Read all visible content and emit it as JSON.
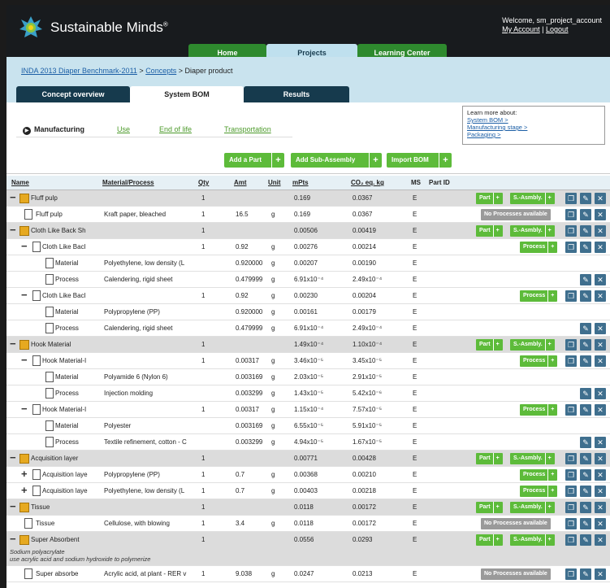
{
  "app": {
    "brand": "Sustainable Minds",
    "brand_mark": "®",
    "welcome": "Welcome, sm_project_account",
    "my_account": "My Account",
    "separator": " | ",
    "logout": "Logout"
  },
  "nav": {
    "tabs": [
      {
        "label": "Home",
        "color": "#2e8a2e"
      },
      {
        "label": "Projects",
        "color": "#bfe0ee"
      },
      {
        "label": "Learning Center",
        "color": "#2e8a2e"
      }
    ]
  },
  "breadcrumb": {
    "part1": "INDA 2013 Diaper Benchmark-2011",
    "sep1": " > ",
    "part2": "Concepts",
    "sep2": " > ",
    "current": "Diaper product"
  },
  "concept_tabs": [
    "Concept overview",
    "System BOM",
    "Results"
  ],
  "stage_tabs": {
    "active": "Manufacturing",
    "others": [
      "Use",
      "End of life",
      "Transportation"
    ]
  },
  "learn_more": {
    "title": "Learn more about:",
    "links": [
      "System BOM >",
      "Manufacturing stage >",
      "Packaging >"
    ]
  },
  "actions": {
    "add_part": "Add a Part",
    "add_sub": "Add Sub-Assembly",
    "import": "Import BOM",
    "plus": "+"
  },
  "columns": {
    "name": "Name",
    "material": "Material/Process",
    "qty": "Qty",
    "amt": "Amt",
    "unit": "Unit",
    "mpts": "mPts",
    "co2": "CO₂ eq. kg",
    "ms": "MS",
    "partid": "Part ID"
  },
  "row_buttons": {
    "part": "Part",
    "sasm": "S.-Asmbly.",
    "process": "Process",
    "noproc": "No Processes available",
    "plus": "+"
  },
  "rows": [
    {
      "kind": "grp",
      "exp": "−",
      "name": "Fluff pulp",
      "qty": "1",
      "mpts": "0.169",
      "co2": "0.0367",
      "ms": "E",
      "btns": "grp"
    },
    {
      "kind": "item",
      "name": "Fluff pulp",
      "mat": "Kraft paper, bleached",
      "qty": "1",
      "amt": "16.5",
      "unit": "g",
      "mpts": "0.169",
      "co2": "0.0367",
      "ms": "E",
      "btns": "noproc"
    },
    {
      "kind": "grp",
      "exp": "−",
      "name": "Cloth Like Back Sh",
      "qty": "1",
      "mpts": "0.00506",
      "co2": "0.00419",
      "ms": "E",
      "btns": "grp"
    },
    {
      "kind": "sub",
      "exp": "−",
      "name": "Cloth Like Bacl",
      "qty": "1",
      "amt": "0.92",
      "unit": "g",
      "mpts": "0.00276",
      "co2": "0.00214",
      "ms": "E",
      "btns": "process"
    },
    {
      "kind": "leaf",
      "name": "Material",
      "mat": "Polyethylene, low density (L",
      "amt": "0.920000",
      "unit": "g",
      "mpts": "0.00207",
      "co2": "0.00190",
      "ms": "E",
      "btns": "none"
    },
    {
      "kind": "leaf",
      "name": "Process",
      "mat": "Calendering, rigid sheet",
      "amt": "0.479999",
      "unit": "g",
      "mpts": "6.91x10⁻⁴",
      "co2": "2.49x10⁻⁴",
      "ms": "E",
      "btns": "edit"
    },
    {
      "kind": "sub",
      "exp": "−",
      "name": "Cloth Like Bacl",
      "qty": "1",
      "amt": "0.92",
      "unit": "g",
      "mpts": "0.00230",
      "co2": "0.00204",
      "ms": "E",
      "btns": "process"
    },
    {
      "kind": "leaf",
      "name": "Material",
      "mat": "Polypropylene (PP)",
      "amt": "0.920000",
      "unit": "g",
      "mpts": "0.00161",
      "co2": "0.00179",
      "ms": "E",
      "btns": "none"
    },
    {
      "kind": "leaf",
      "name": "Process",
      "mat": "Calendering, rigid sheet",
      "amt": "0.479999",
      "unit": "g",
      "mpts": "6.91x10⁻⁴",
      "co2": "2.49x10⁻⁴",
      "ms": "E",
      "btns": "edit"
    },
    {
      "kind": "grp",
      "exp": "−",
      "name": "Hook Material",
      "qty": "1",
      "mpts": "1.49x10⁻⁴",
      "co2": "1.10x10⁻⁴",
      "ms": "E",
      "btns": "grp"
    },
    {
      "kind": "sub",
      "exp": "−",
      "name": "Hook Material-I",
      "qty": "1",
      "amt": "0.00317",
      "unit": "g",
      "mpts": "3.46x10⁻⁵",
      "co2": "3.45x10⁻⁵",
      "ms": "E",
      "btns": "process"
    },
    {
      "kind": "leaf",
      "name": "Material",
      "mat": "Polyamide 6 (Nylon 6)",
      "amt": "0.003169",
      "unit": "g",
      "mpts": "2.03x10⁻⁵",
      "co2": "2.91x10⁻⁵",
      "ms": "E",
      "btns": "none"
    },
    {
      "kind": "leaf",
      "name": "Process",
      "mat": "Injection molding",
      "amt": "0.003299",
      "unit": "g",
      "mpts": "1.43x10⁻⁵",
      "co2": "5.42x10⁻⁶",
      "ms": "E",
      "btns": "edit"
    },
    {
      "kind": "sub",
      "exp": "−",
      "name": "Hook Material-I",
      "qty": "1",
      "amt": "0.00317",
      "unit": "g",
      "mpts": "1.15x10⁻⁴",
      "co2": "7.57x10⁻⁵",
      "ms": "E",
      "btns": "process"
    },
    {
      "kind": "leaf",
      "name": "Material",
      "mat": "Polyester",
      "amt": "0.003169",
      "unit": "g",
      "mpts": "6.55x10⁻⁵",
      "co2": "5.91x10⁻⁵",
      "ms": "E",
      "btns": "none"
    },
    {
      "kind": "leaf",
      "name": "Process",
      "mat": "Textile refinement, cotton - C",
      "amt": "0.003299",
      "unit": "g",
      "mpts": "4.94x10⁻⁵",
      "co2": "1.67x10⁻⁵",
      "ms": "E",
      "btns": "edit"
    },
    {
      "kind": "grp",
      "exp": "−",
      "name": "Acquisition layer",
      "qty": "1",
      "mpts": "0.00771",
      "co2": "0.00428",
      "ms": "E",
      "btns": "grp"
    },
    {
      "kind": "sub",
      "exp": "+",
      "name": "Acquisition laye",
      "mat": "Polypropylene (PP)",
      "qty": "1",
      "amt": "0.7",
      "unit": "g",
      "mpts": "0.00368",
      "co2": "0.00210",
      "ms": "E",
      "btns": "process"
    },
    {
      "kind": "sub",
      "exp": "+",
      "name": "Acquisition laye",
      "mat": "Polyethylene, low density (L",
      "qty": "1",
      "amt": "0.7",
      "unit": "g",
      "mpts": "0.00403",
      "co2": "0.00218",
      "ms": "E",
      "btns": "process"
    },
    {
      "kind": "grp",
      "exp": "−",
      "name": "Tissue",
      "qty": "1",
      "mpts": "0.0118",
      "co2": "0.00172",
      "ms": "E",
      "btns": "grp"
    },
    {
      "kind": "item",
      "name": "Tissue",
      "mat": "Cellulose, with blowing",
      "qty": "1",
      "amt": "3.4",
      "unit": "g",
      "mpts": "0.0118",
      "co2": "0.00172",
      "ms": "E",
      "btns": "noproc"
    },
    {
      "kind": "grp",
      "exp": "−",
      "name": "Super Absorbent",
      "qty": "1",
      "mpts": "0.0556",
      "co2": "0.0293",
      "ms": "E",
      "btns": "grp",
      "note1": "Sodium polyacrylate",
      "note2": "use acrylic acid and sodium hydroxide to polymerize"
    },
    {
      "kind": "item",
      "name": "Super absorbe",
      "mat": "Acrylic acid, at plant - RER v",
      "qty": "1",
      "amt": "9.038",
      "unit": "g",
      "mpts": "0.0247",
      "co2": "0.0213",
      "ms": "E",
      "btns": "noproc"
    }
  ]
}
